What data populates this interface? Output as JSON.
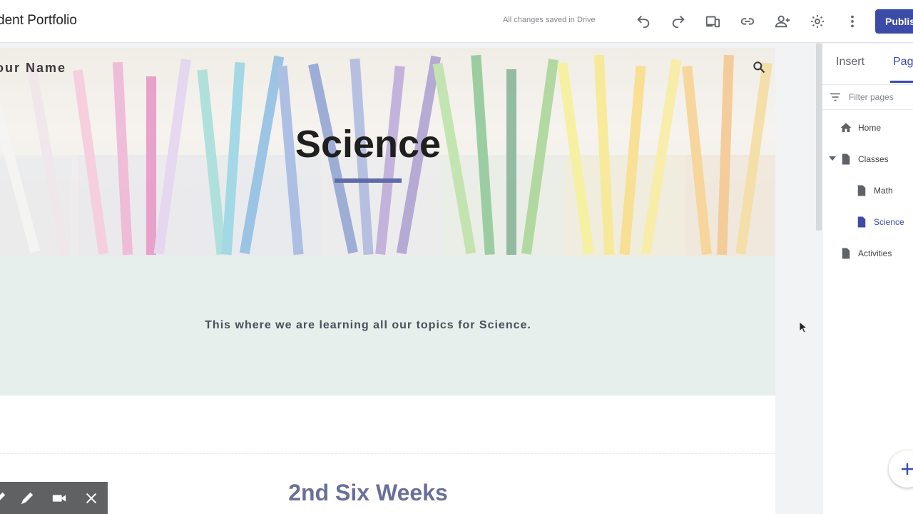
{
  "header": {
    "site_title": "dent Portfolio",
    "save_status": "All changes saved in Drive",
    "publish_label": "Publis",
    "icons": [
      "undo-icon",
      "redo-icon",
      "preview-icon",
      "link-icon",
      "share-icon",
      "settings-icon",
      "more-icon"
    ]
  },
  "page": {
    "site_name": "our Name",
    "title": "Science",
    "intro": "This where we are learning all our topics for Science.",
    "section_heading": "2nd Six Weeks"
  },
  "side_panel": {
    "tabs": [
      {
        "label": "Insert",
        "active": false
      },
      {
        "label": "Page",
        "active": true
      }
    ],
    "filter_placeholder": "Filter pages",
    "pages": [
      {
        "label": "Home",
        "icon": "home-icon"
      },
      {
        "label": "Classes",
        "icon": "page-icon",
        "expanded": true
      },
      {
        "label": "Math",
        "icon": "page-icon"
      },
      {
        "label": "Science",
        "icon": "page-icon",
        "selected": true
      },
      {
        "label": "Activities",
        "icon": "page-icon"
      }
    ]
  },
  "colors": {
    "accent": "#3c4ba8",
    "intro_bg": "#e7efec",
    "section_heading": "#6a6f9a"
  }
}
